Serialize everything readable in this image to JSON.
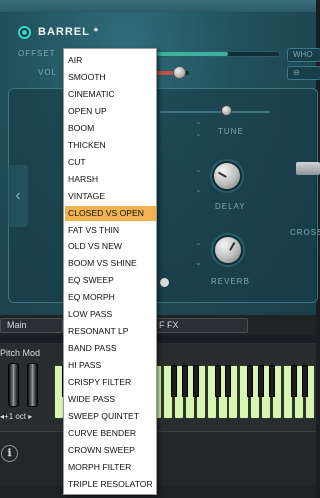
{
  "instrument": {
    "title": "BARREL *",
    "offset_label": "OFFSET",
    "vol_label": "VOL",
    "who_button": "WHO",
    "loop_button": "⊖",
    "tune_label": "TUNE",
    "delay_label": "DELAY",
    "reverb_label": "REVERB",
    "cross_label": "CROSS",
    "offset_level": 0.6,
    "vol_level": 0.7,
    "accent_color": "#38d6c4",
    "panel_color": "#2a5f6b"
  },
  "tabs": {
    "main_label": "Main",
    "fx_label": "F FX"
  },
  "keyboard": {
    "pitch_mod_label": "Pitch Mod",
    "octave_label": "◂+1 oct ▸",
    "key_color": "#d8f5b3"
  },
  "footer": {
    "info_icon": "ℹ"
  },
  "dropdown": {
    "selected_index": 9,
    "highlight_color": "#f0b34f",
    "items": [
      "AIR",
      "SMOOTH",
      "CINEMATIC",
      "OPEN UP",
      "BOOM",
      "THICKEN",
      "CUT",
      "HARSH",
      "VINTAGE",
      "CLOSED VS OPEN",
      "FAT VS THIN",
      "OLD VS NEW",
      "BOOM VS SHINE",
      "EQ SWEEP",
      "EQ MORPH",
      "LOW PASS",
      "RESONANT LP",
      "BAND PASS",
      "HI PASS",
      "CRISPY FILTER",
      "WIDE PASS",
      "SWEEP QUINTET",
      "CURVE BENDER",
      "CROWN SWEEP",
      "MORPH FILTER",
      "TRIPLE RESOLATOR"
    ]
  }
}
